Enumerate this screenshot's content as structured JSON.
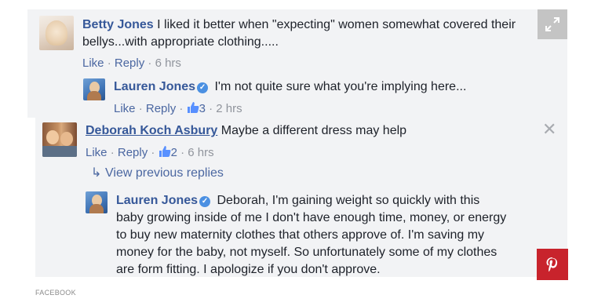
{
  "comments": [
    {
      "author": "Betty Jones",
      "text_line1": "I liked it better when \"expecting\" women somewhat covered their",
      "text_line2": "bellys...with appropriate clothing.....",
      "like": "Like",
      "reply": "Reply",
      "time": "6 hrs"
    },
    {
      "author": "Lauren Jones",
      "text": "I'm not quite sure what you're implying here...",
      "like": "Like",
      "reply": "Reply",
      "reactions": "3",
      "time": "2 hrs"
    },
    {
      "author": "Deborah Koch Asbury",
      "text": "Maybe a different dress may help",
      "like": "Like",
      "reply": "Reply",
      "reactions": "2",
      "time": "6 hrs",
      "view_replies": "View previous replies"
    },
    {
      "author": "Lauren Jones",
      "text_lines": [
        "Deborah, I'm gaining weight so quickly with this",
        "baby growing inside of me I don't have enough time, money, or energy",
        "to buy new maternity clothes that others approve of. I'm saving my",
        "money for the baby, not myself. So unfortunately some of my clothes",
        "are form fitting. I apologize if you don't approve."
      ]
    }
  ],
  "separator": "·",
  "credit": "FACEBOOK",
  "icons": {
    "expand": "expand-icon",
    "pinterest": "pinterest-icon",
    "close": "close-icon",
    "verified": "verified-badge-icon",
    "thumbs_up": "thumbs-up-icon",
    "reply_arrow": "reply-arrow-icon"
  },
  "colors": {
    "name": "#365899",
    "meta": "#90949c",
    "panel": "#f2f3f5",
    "pinterest": "#c8232c",
    "verified": "#4b90e2"
  }
}
